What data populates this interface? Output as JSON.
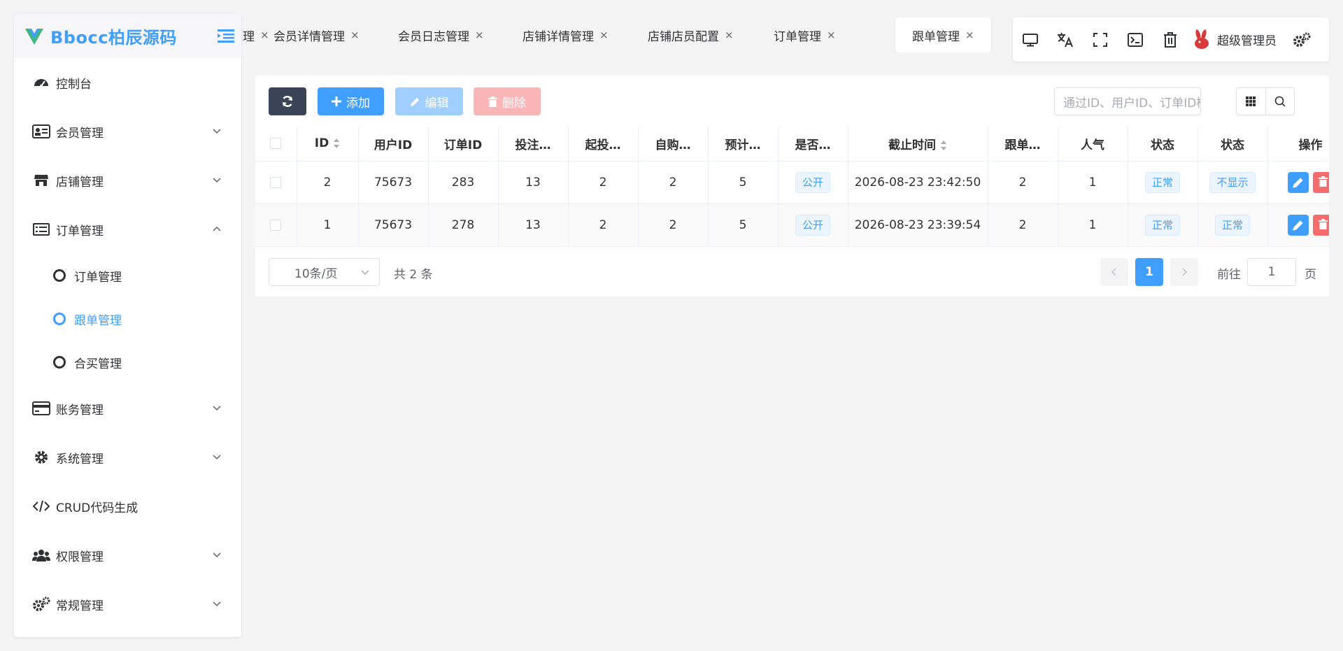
{
  "brand": {
    "name": "Bbocc柏辰源码"
  },
  "sidebar": {
    "items": [
      {
        "label": "控制台"
      },
      {
        "label": "会员管理"
      },
      {
        "label": "店铺管理"
      },
      {
        "label": "订单管理"
      },
      {
        "label": "账务管理"
      },
      {
        "label": "系统管理"
      },
      {
        "label": "CRUD代码生成"
      },
      {
        "label": "权限管理"
      },
      {
        "label": "常规管理"
      }
    ],
    "order_sub": [
      {
        "label": "订单管理"
      },
      {
        "label": "跟单管理"
      },
      {
        "label": "合买管理"
      }
    ]
  },
  "tabs": [
    {
      "label": "理"
    },
    {
      "label": "会员详情管理"
    },
    {
      "label": "会员日志管理"
    },
    {
      "label": "店铺详情管理"
    },
    {
      "label": "店铺店员配置"
    },
    {
      "label": "订单管理"
    },
    {
      "label": "跟单管理"
    }
  ],
  "header": {
    "admin_name": "超级管理员"
  },
  "toolbar": {
    "add_label": "添加",
    "edit_label": "编辑",
    "delete_label": "删除",
    "search_placeholder": "通过ID、用户ID、订单ID模糊搜索"
  },
  "table": {
    "columns": [
      "ID",
      "用户ID",
      "订单ID",
      "投注…",
      "起投…",
      "自购…",
      "预计…",
      "是否…",
      "截止时间",
      "跟单…",
      "人气",
      "状态",
      "状态",
      "操作"
    ],
    "rows": [
      {
        "id": "2",
        "user_id": "75673",
        "order_id": "283",
        "bet": "13",
        "start": "2",
        "self": "2",
        "expect": "5",
        "public": "公开",
        "deadline": "2026-08-23 23:42:50",
        "follow": "2",
        "popularity": "1",
        "status": "正常",
        "status2": "不显示"
      },
      {
        "id": "1",
        "user_id": "75673",
        "order_id": "278",
        "bet": "13",
        "start": "2",
        "self": "2",
        "expect": "5",
        "public": "公开",
        "deadline": "2026-08-23 23:39:54",
        "follow": "2",
        "popularity": "1",
        "status": "正常",
        "status2": "正常"
      }
    ]
  },
  "pagination": {
    "page_size": "10条/页",
    "total": "共 2 条",
    "current_page": "1",
    "goto_label": "前往",
    "goto_value": "1",
    "goto_suffix": "页"
  },
  "colors": {
    "primary": "#409eff",
    "danger": "#f56c6c",
    "dark": "#3b4356"
  }
}
